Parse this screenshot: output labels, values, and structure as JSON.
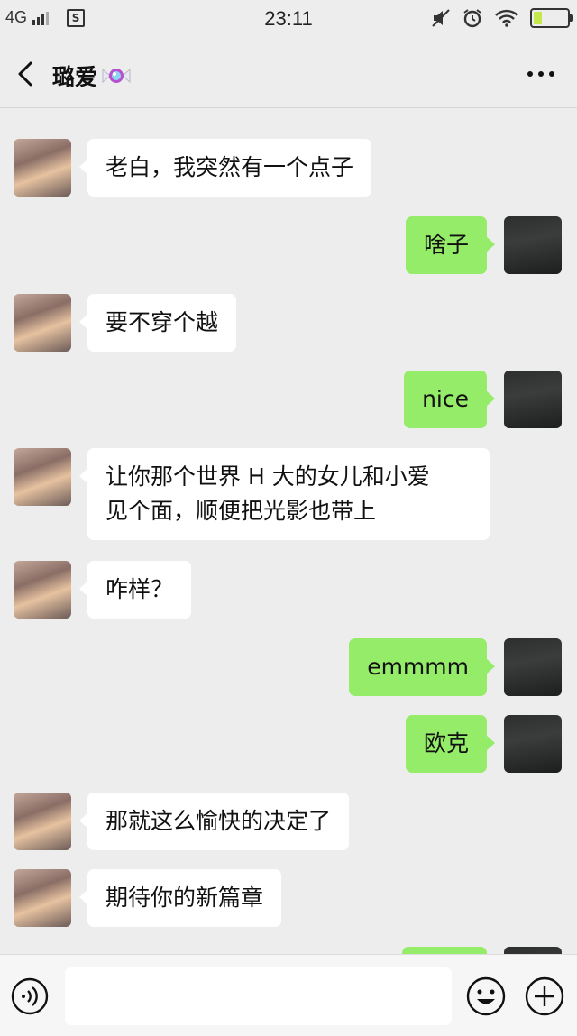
{
  "status_bar": {
    "network": "4G",
    "time": "23:11",
    "battery_level": 0.25,
    "icons": [
      "signal-icon",
      "sim-icon",
      "mute-icon",
      "alarm-icon",
      "wifi-icon",
      "battery-icon"
    ]
  },
  "nav": {
    "title": "璐爱",
    "title_emoji_icon": "candy-icon",
    "back_icon": "chevron-left-icon",
    "more_icon": "more-dots-icon"
  },
  "messages": [
    {
      "side": "left",
      "text": "老白，我突然有一个点子"
    },
    {
      "side": "right",
      "text": "啥子"
    },
    {
      "side": "left",
      "text": "要不穿个越"
    },
    {
      "side": "right",
      "text": "nice"
    },
    {
      "side": "left",
      "lines": [
        "让你那个世界 H 大的女儿和小爱",
        "见个面，顺便把光影也带上"
      ]
    },
    {
      "side": "left",
      "text": "咋样？"
    },
    {
      "side": "right",
      "text": "emmmm"
    },
    {
      "side": "right",
      "text": "欧克"
    },
    {
      "side": "left",
      "text": "那就这么愉快的决定了"
    },
    {
      "side": "left",
      "text": "期待你的新篇章"
    }
  ],
  "input_bar": {
    "voice_icon": "voice-icon",
    "input_value": "",
    "emoji_icon": "emoji-icon",
    "plus_icon": "plus-icon"
  },
  "colors": {
    "background": "#ededed",
    "bubble_self": "#95ec69",
    "bubble_other": "#ffffff"
  }
}
